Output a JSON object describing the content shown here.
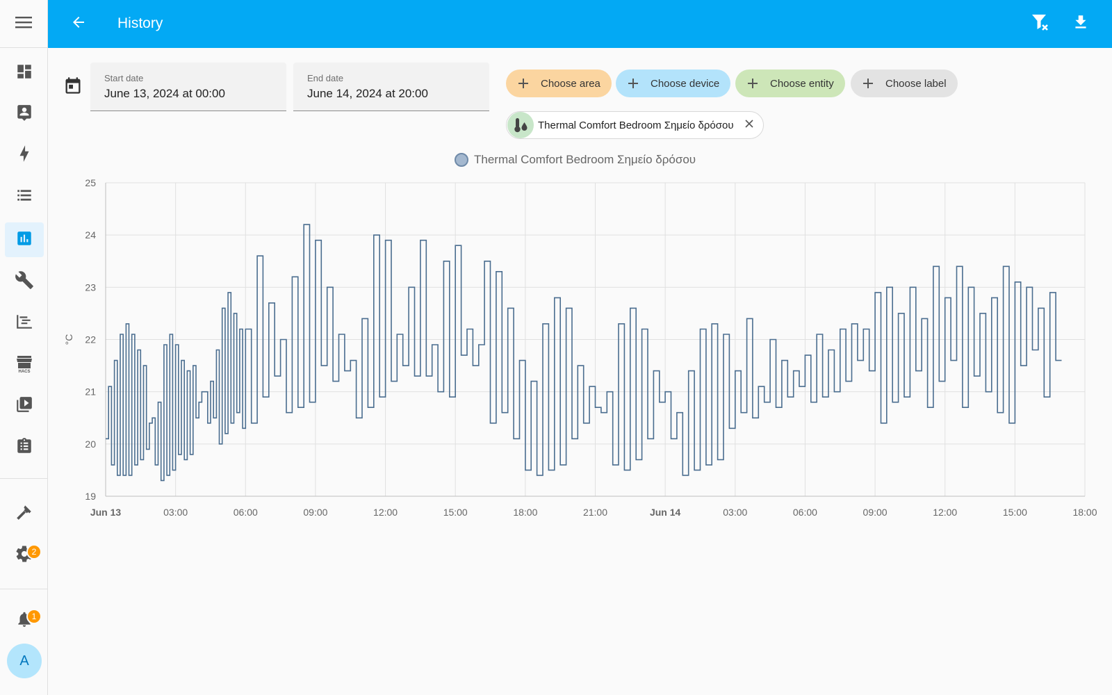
{
  "header": {
    "title": "History",
    "accent_color": "#03a9f4"
  },
  "sidebar": {
    "menu_icon": "hamburger-menu-icon",
    "items": [
      {
        "name": "overview",
        "icon": "dashboard-icon",
        "active": false
      },
      {
        "name": "map",
        "icon": "account-box-icon",
        "active": false
      },
      {
        "name": "energy",
        "icon": "lightning-bolt-icon",
        "active": false
      },
      {
        "name": "logbook",
        "icon": "list-icon",
        "active": false
      },
      {
        "name": "history",
        "icon": "bar-chart-icon",
        "active": true
      },
      {
        "name": "developer",
        "icon": "wrench-icon",
        "active": false
      },
      {
        "name": "media",
        "icon": "chart-gantt-icon",
        "active": false
      },
      {
        "name": "hacs",
        "icon": "store-icon",
        "active": false
      },
      {
        "name": "media-browser",
        "icon": "play-box-multiple-icon",
        "active": false
      },
      {
        "name": "todo",
        "icon": "clipboard-list-icon",
        "active": false
      }
    ],
    "developer_tools_icon": "hammer-icon",
    "settings_badge": "2",
    "notifications_badge": "1",
    "user_initial": "A",
    "hacs_label": "HACS"
  },
  "dates": {
    "start_label": "Start date",
    "start_value": "June 13, 2024 at 00:00",
    "end_label": "End date",
    "end_value": "June 14, 2024 at 20:00"
  },
  "chips": {
    "area": "Choose area",
    "device": "Choose device",
    "entity": "Choose entity",
    "label": "Choose label"
  },
  "selected_entity": "Thermal Comfort Bedroom Σημείο δρόσου",
  "chart_data": {
    "type": "line",
    "title": "",
    "series": [
      {
        "name": "Thermal Comfort Bedroom Σημείο δρόσου",
        "color": "#4a6d8f",
        "x_hours": [
          0.0,
          0.125,
          0.25,
          0.375,
          0.5,
          0.625,
          0.75,
          0.875,
          1.0,
          1.125,
          1.25,
          1.375,
          1.5,
          1.625,
          1.75,
          1.875,
          2.0,
          2.125,
          2.25,
          2.375,
          2.5,
          2.625,
          2.75,
          2.875,
          3.0,
          3.125,
          3.25,
          3.375,
          3.5,
          3.625,
          3.75,
          3.875,
          4.0,
          4.125,
          4.25,
          4.375,
          4.5,
          4.625,
          4.75,
          4.875,
          5.0,
          5.125,
          5.25,
          5.375,
          5.5,
          5.625,
          5.75,
          5.875,
          6.0,
          6.25,
          6.5,
          6.75,
          7.0,
          7.25,
          7.5,
          7.75,
          8.0,
          8.25,
          8.5,
          8.75,
          9.0,
          9.25,
          9.5,
          9.75,
          10.0,
          10.25,
          10.5,
          10.75,
          11.0,
          11.25,
          11.5,
          11.75,
          12.0,
          12.25,
          12.5,
          12.75,
          13.0,
          13.25,
          13.5,
          13.75,
          14.0,
          14.25,
          14.5,
          14.75,
          15.0,
          15.25,
          15.5,
          15.75,
          16.0,
          16.25,
          16.5,
          16.75,
          17.0,
          17.25,
          17.5,
          17.75,
          18.0,
          18.25,
          18.5,
          18.75,
          19.0,
          19.25,
          19.5,
          19.75,
          20.0,
          20.25,
          20.5,
          20.75,
          21.0,
          21.25,
          21.5,
          21.75,
          22.0,
          22.25,
          22.5,
          22.75,
          23.0,
          23.25,
          23.5,
          23.75,
          24.0,
          24.25,
          24.5,
          24.75,
          25.0,
          25.25,
          25.5,
          25.75,
          26.0,
          26.25,
          26.5,
          26.75,
          27.0,
          27.25,
          27.5,
          27.75,
          28.0,
          28.25,
          28.5,
          28.75,
          29.0,
          29.25,
          29.5,
          29.75,
          30.0,
          30.25,
          30.5,
          30.75,
          31.0,
          31.25,
          31.5,
          31.75,
          32.0,
          32.25,
          32.5,
          32.75,
          33.0,
          33.25,
          33.5,
          33.75,
          34.0,
          34.25,
          34.5,
          34.75,
          35.0,
          35.25,
          35.5,
          35.75,
          36.0,
          36.25,
          36.5,
          36.75,
          37.0,
          37.25,
          37.5,
          37.75,
          38.0,
          38.25,
          38.5,
          38.75,
          39.0,
          39.25,
          39.5,
          39.75,
          40.0,
          40.25,
          40.5,
          40.75,
          41.0,
          41.25,
          41.5,
          41.75,
          42.0,
          42.25
        ],
        "values": [
          20.1,
          21.1,
          19.6,
          21.6,
          19.4,
          22.1,
          19.4,
          22.3,
          19.4,
          22.1,
          19.6,
          21.8,
          19.7,
          21.5,
          19.9,
          20.4,
          20.5,
          19.6,
          20.8,
          19.3,
          21.9,
          19.4,
          22.1,
          19.5,
          21.9,
          19.8,
          21.6,
          19.7,
          21.4,
          19.8,
          21.5,
          20.5,
          20.8,
          21.0,
          21.0,
          20.4,
          21.2,
          20.5,
          21.8,
          20.0,
          22.6,
          20.2,
          22.9,
          20.4,
          22.5,
          20.6,
          22.2,
          20.3,
          22.2,
          20.4,
          23.6,
          20.9,
          22.7,
          21.3,
          22.0,
          20.6,
          23.2,
          20.7,
          24.2,
          20.8,
          23.9,
          21.5,
          23.0,
          21.2,
          22.1,
          21.4,
          21.6,
          20.5,
          22.4,
          20.7,
          24.0,
          20.9,
          23.9,
          21.2,
          22.1,
          21.5,
          23.0,
          21.3,
          23.9,
          21.3,
          21.9,
          21.0,
          23.5,
          20.9,
          23.8,
          21.7,
          22.2,
          21.5,
          21.9,
          23.5,
          20.4,
          23.3,
          20.6,
          22.6,
          20.1,
          21.6,
          19.5,
          21.2,
          19.4,
          22.3,
          19.5,
          22.8,
          19.6,
          22.6,
          20.1,
          21.5,
          20.4,
          21.1,
          20.7,
          20.6,
          21.0,
          19.6,
          22.3,
          19.5,
          22.6,
          19.7,
          22.2,
          20.1,
          21.4,
          20.8,
          21.0,
          20.1,
          20.6,
          19.4,
          21.4,
          19.5,
          22.2,
          19.6,
          22.3,
          19.7,
          22.1,
          20.3,
          21.4,
          20.6,
          22.4,
          20.5,
          21.1,
          20.8,
          22.0,
          20.7,
          21.6,
          20.9,
          21.4,
          21.1,
          21.7,
          20.8,
          22.1,
          20.9,
          21.8,
          21.0,
          22.2,
          21.2,
          22.3,
          21.6,
          22.2,
          21.4,
          22.9,
          20.4,
          23.0,
          20.8,
          22.5,
          20.9,
          23.0,
          21.4,
          22.4,
          20.7,
          23.4,
          21.2,
          22.8,
          21.6,
          23.4,
          20.7,
          23.0,
          21.3,
          22.5,
          21.0,
          22.8,
          20.6,
          23.4,
          20.4,
          23.1,
          21.5,
          23.0,
          21.8,
          22.6,
          20.9,
          22.9,
          21.6
        ],
        "note_x": "hours since start"
      }
    ],
    "x_ticks": [
      "Jun 13",
      "03:00",
      "06:00",
      "09:00",
      "12:00",
      "15:00",
      "18:00",
      "21:00",
      "Jun 14",
      "03:00",
      "06:00",
      "09:00",
      "12:00",
      "15:00",
      "18:00"
    ],
    "x_ticks_bold": [
      true,
      false,
      false,
      false,
      false,
      false,
      false,
      false,
      true,
      false,
      false,
      false,
      false,
      false,
      false
    ],
    "y_ticks": [
      "19",
      "20",
      "21",
      "22",
      "23",
      "24",
      "25"
    ],
    "ylabel": "°C",
    "ylim": [
      19,
      25
    ],
    "xlim_hours": [
      0,
      42
    ],
    "grid": true,
    "legend": "top-center"
  }
}
